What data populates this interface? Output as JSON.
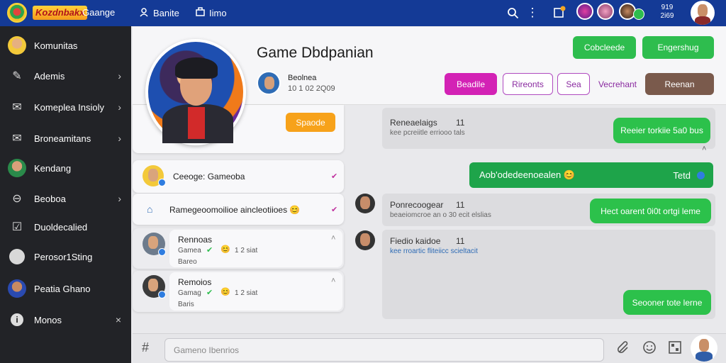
{
  "topbar": {
    "logo_text": "Kozdnbakx",
    "nav": [
      "Gaange",
      "Banite",
      "Iimo"
    ],
    "status_top": "919",
    "status_bottom": "2i69"
  },
  "sidebar": {
    "items": [
      {
        "label": "Komunitas",
        "icon": "avatar-icon",
        "chevron": ""
      },
      {
        "label": "Ademis",
        "icon": "pencil-icon",
        "chevron": "›"
      },
      {
        "label": "Komeplea Insioly",
        "icon": "mail-icon",
        "chevron": "›"
      },
      {
        "label": "Broneamitans",
        "icon": "inbox-icon",
        "chevron": "›"
      },
      {
        "label": "Kendang",
        "icon": "avatar-icon",
        "chevron": ""
      },
      {
        "label": "Beoboa",
        "icon": "link-icon",
        "chevron": "›"
      },
      {
        "label": "Duoldecalied",
        "icon": "check-square-icon",
        "chevron": ""
      },
      {
        "label": "Perosor1Sting",
        "icon": "avatar-icon",
        "chevron": ""
      },
      {
        "label": "Peatia Ghano",
        "icon": "avatar-icon",
        "chevron": ""
      },
      {
        "label": "Monos",
        "icon": "info-icon",
        "chevron": "×"
      }
    ]
  },
  "header": {
    "game_title": "Game Dbdpanian",
    "author_name": "Beolnea",
    "author_meta": "10 1 02 2Q09",
    "btn_cobcleede": "Cobcleede",
    "btn_engershug": "Engershug",
    "btn_beadile": "Beadile",
    "btn_rireonts": "Rireonts",
    "btn_sea": "Sea",
    "btn_vecrehant": "Vecrehant",
    "btn_reenan": "Reenan",
    "btn_spaode": "Spaode"
  },
  "left_cards": {
    "card1_text": "Ceeoge: Gameoba",
    "card2_text": "Ramegeoomoilioe aincleotiioes 😊",
    "card3_title": "Rennoas",
    "card3_meta": "Gamea",
    "card3_stat": "1 2 siat",
    "card3_sub": "Bareo",
    "card4_title": "Remoios",
    "card4_meta": "Gamag",
    "card4_stat": "1 2 siat",
    "card4_sub": "Baris"
  },
  "chat": {
    "msg1_title": "Reneaelaigs",
    "msg1_count": "11",
    "msg1_sub": "kee pcreiitle erriooo tals",
    "bubble1": "Reeier torkiie 5a0 bus",
    "highlight_text": "Aob'odedeenoealen 😊",
    "highlight_right": "Tetd",
    "msg2_title": "Ponrecoogear",
    "msg2_count": "11",
    "msg2_sub": "beaeiomcroe an o 30 ecit elslias",
    "bubble2": "Hect oarent 0i0t ortgi leme",
    "msg3_title": "Fiedio kaidoe",
    "msg3_count": "11",
    "msg3_sub": "kee rroartic fliteiicc scieltacit",
    "bubble3": "Seooner tote lerne"
  },
  "composer": {
    "placeholder": "Gameno Ibenrios"
  },
  "colors": {
    "topbar": "#143a96",
    "sidebar": "#222327",
    "green": "#2ebd4e",
    "magenta": "#d322b5",
    "brown": "#7a5a4c",
    "orange": "#f7a21a"
  }
}
